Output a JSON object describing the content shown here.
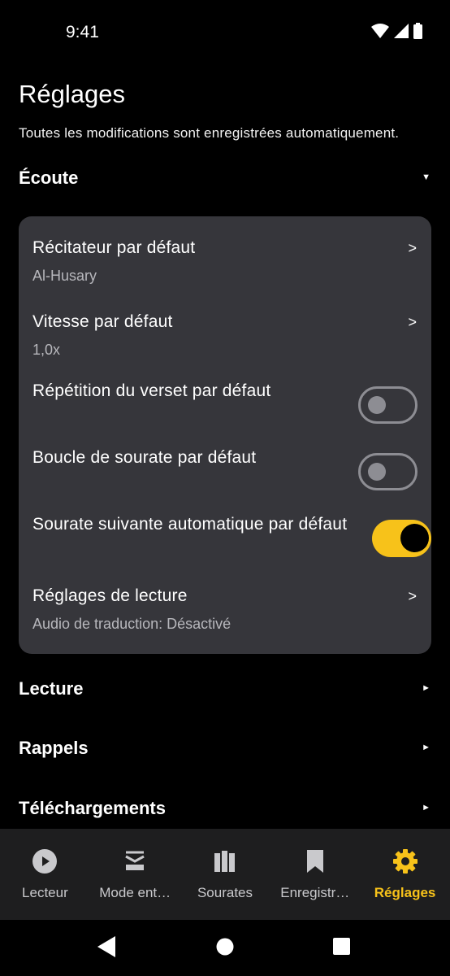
{
  "status": {
    "time": "9:41"
  },
  "header": {
    "title": "Réglages",
    "subtitle": "Toutes les modifications sont enregistrées automatiquement."
  },
  "sections": {
    "listening": {
      "title": "Écoute",
      "arrow": "▼"
    },
    "reading": {
      "title": "Lecture",
      "arrow": "►"
    },
    "reminders": {
      "title": "Rappels",
      "arrow": "►"
    },
    "downloads": {
      "title": "Téléchargements",
      "arrow": "►"
    }
  },
  "listening": {
    "reciter": {
      "title": "Récitateur par défaut",
      "value": "Al-Husary",
      "chevron": ">"
    },
    "speed": {
      "title": "Vitesse par défaut",
      "value": "1,0x",
      "chevron": ">"
    },
    "repeat_verse": {
      "title": "Répétition du verset par défaut",
      "on": false
    },
    "loop_surah": {
      "title": "Boucle de sourate par défaut",
      "on": false
    },
    "auto_next": {
      "title": "Sourate suivante automatique par défaut",
      "on": true
    },
    "reading_settings": {
      "title": "Réglages de lecture",
      "value": "Audio de traduction: Désactivé",
      "chevron": ">"
    }
  },
  "nav": [
    {
      "label": "Lecteur",
      "icon": "play-circle-icon",
      "active": false
    },
    {
      "label": "Mode ent…",
      "icon": "stack-icon",
      "active": false
    },
    {
      "label": "Sourates",
      "icon": "books-icon",
      "active": false
    },
    {
      "label": "Enregistr…",
      "icon": "bookmark-icon",
      "active": false
    },
    {
      "label": "Réglages",
      "icon": "gear-icon",
      "active": true
    }
  ],
  "colors": {
    "accent": "#f7c21a",
    "card": "#36363b",
    "background": "#000000",
    "nav": "#1e1e1f"
  }
}
